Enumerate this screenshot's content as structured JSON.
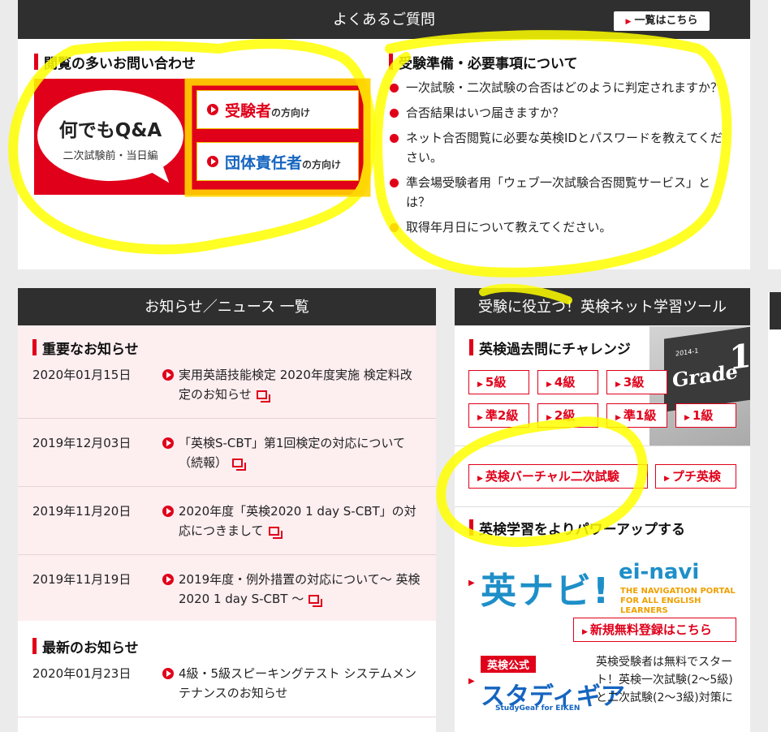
{
  "faq": {
    "bar_title": "よくあるご質問",
    "list_button": "一覧はこちら",
    "popular_heading": "閲覧の多いお問い合わせ",
    "qa_title": "何でもQ&A",
    "qa_subtitle": "二次試験前・当日編",
    "examinee_link_big": "受験者",
    "examinee_link_small": "の方向け",
    "group_link_big": "団体責任者",
    "group_link_small": "の方向け",
    "prep_heading": "受験準備・必要事項について",
    "prep_items": [
      "一次試験・二次試験の合否はどのように判定されますか？",
      "合否結果はいつ届きますか？",
      "ネット合否閲覧に必要な英検IDとパスワードを教えてください。",
      "準会場受験者用「ウェブ一次試験合否閲覧サービス」とは？",
      "取得年月日について教えてください。"
    ]
  },
  "news": {
    "bar_title": "お知らせ／ニュース 一覧",
    "important_heading": "重要なお知らせ",
    "important_items": [
      {
        "date": "2020年01月15日",
        "text": "実用英語技能検定 2020年度実施 検定料改定のお知らせ"
      },
      {
        "date": "2019年12月03日",
        "text": "「英検S-CBT」第1回検定の対応について（続報）"
      },
      {
        "date": "2019年11月20日",
        "text": "2020年度「英検2020 1 day S-CBT」の対応につきまして"
      },
      {
        "date": "2019年11月19日",
        "text": "2019年度・例外措置の対応について〜 英検2020 1 day S-CBT 〜"
      }
    ],
    "latest_heading": "最新のお知らせ",
    "latest_items": [
      {
        "date": "2020年01月23日",
        "text": "4級・5級スピーキングテスト システムメンテナンスのお知らせ"
      }
    ]
  },
  "tools": {
    "bar_title": "受験に役立つ！英検ネット学習ツール",
    "past_heading": "英検過去問にチャレンジ",
    "grade_buttons": [
      "5級",
      "4級",
      "3級",
      "準2級",
      "2級",
      "準1級",
      "1級"
    ],
    "book": {
      "year": "2014-1",
      "word": "Grade",
      "number": "1"
    },
    "virtual_button": "英検バーチャル二次試験",
    "petit_button": "プチ英検",
    "power_heading": "英検学習をよりパワーアップする",
    "einavi_jp": "英ナビ!",
    "einavi_en": "ei-navi",
    "einavi_tagline_1": "THE NAVIGATION PORTAL",
    "einavi_tagline_2": "FOR ALL ENGLISH LEARNERS",
    "register_button": "新規無料登録はこちら",
    "studygear_badge": "英検公式",
    "studygear_logo": "スタディギア",
    "studygear_en": "StudyGear for EIKEN",
    "studygear_desc": "英検受験者は無料でスタート！英検一次試験(2〜5級)と二次試験(2〜3級)対策に"
  },
  "colors": {
    "accent": "#e0001a",
    "dark_bar": "#2f2f2f",
    "highlight": "#ffff00",
    "link_blue": "#1565c0"
  }
}
